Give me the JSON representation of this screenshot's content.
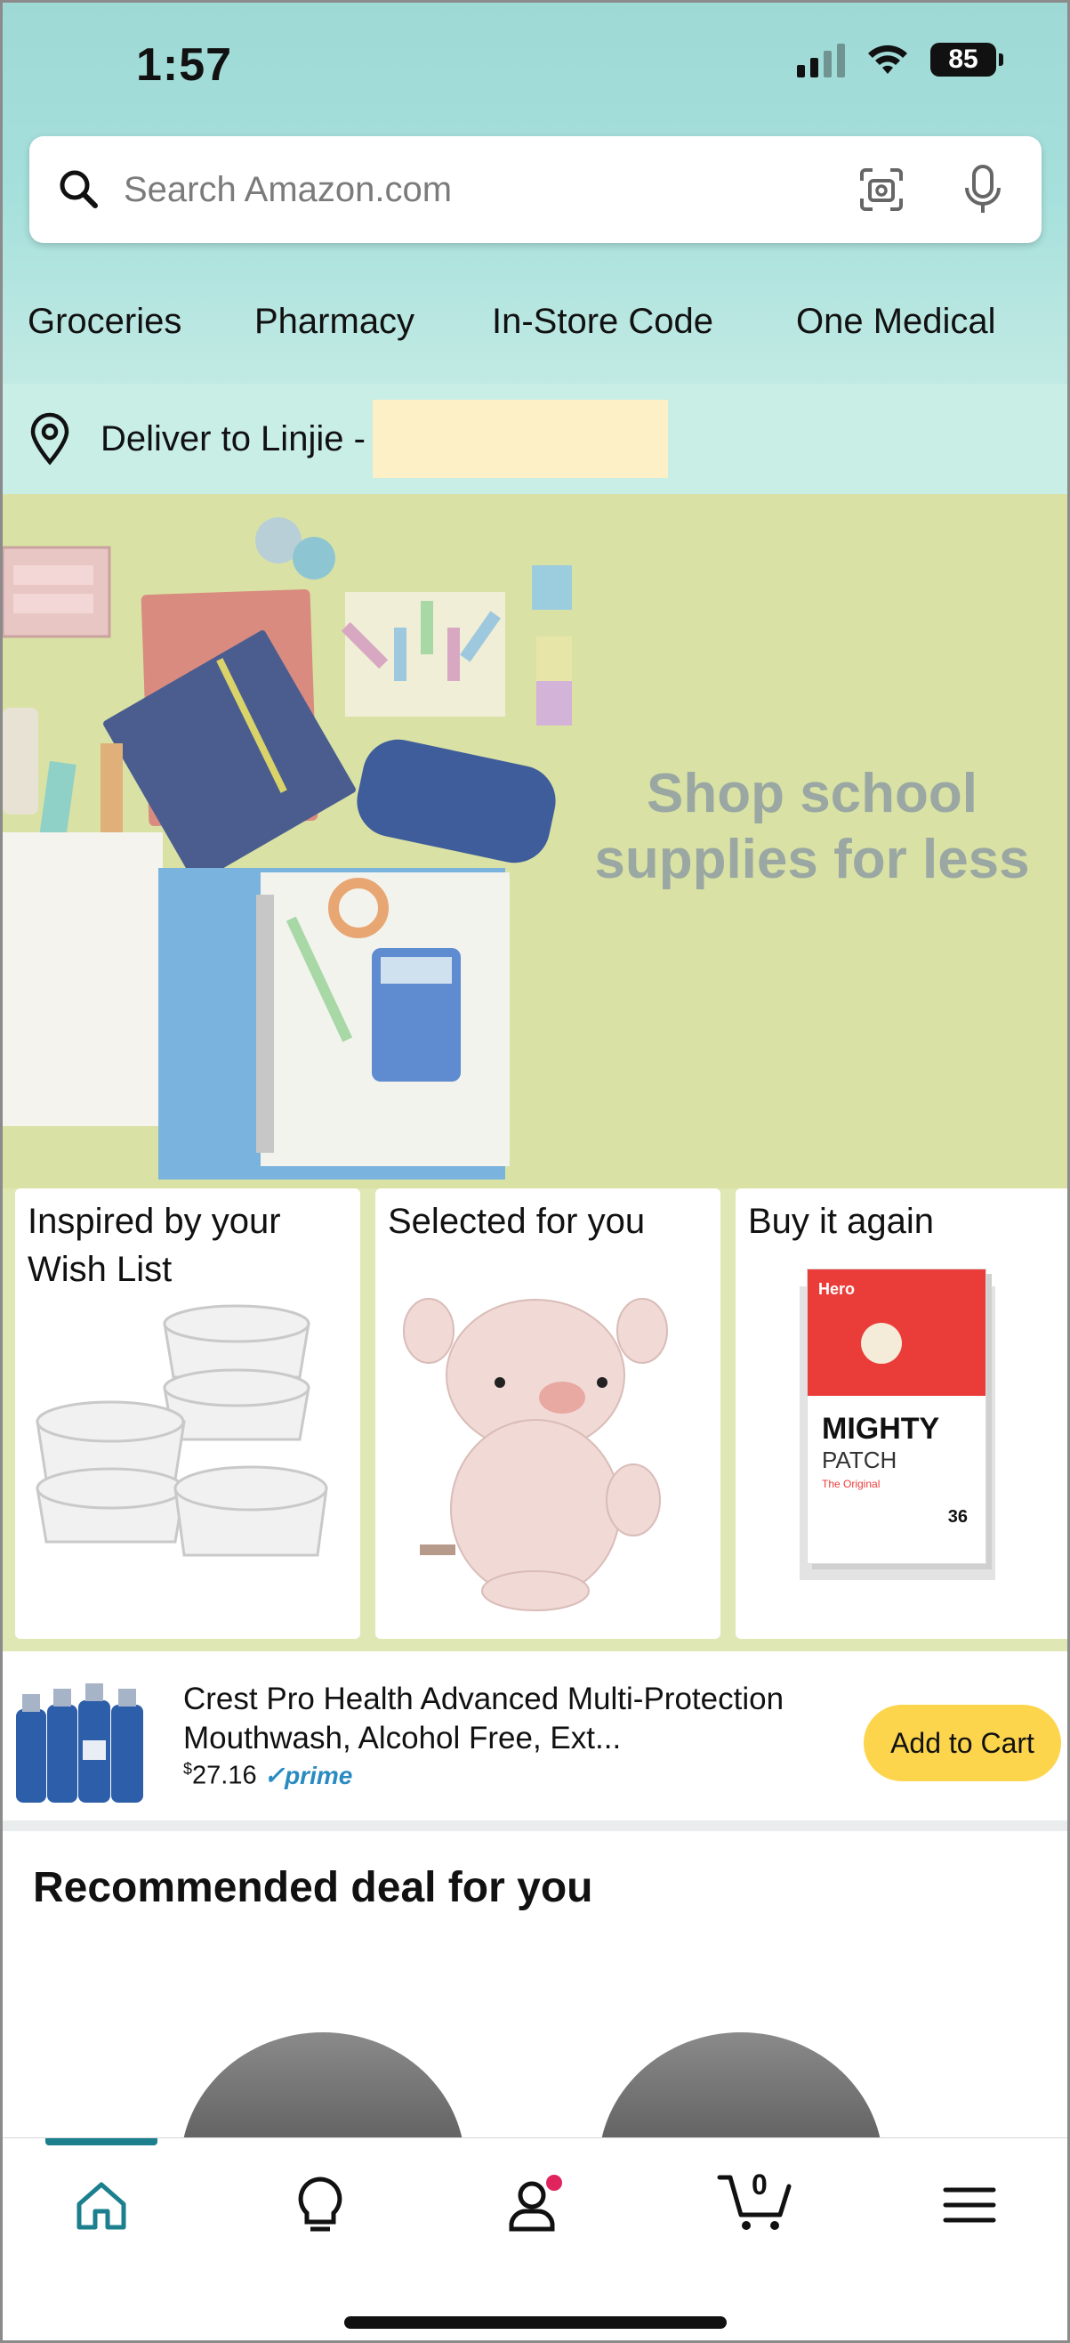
{
  "status_bar": {
    "time": "1:57",
    "battery": "85"
  },
  "search": {
    "placeholder": "Search Amazon.com"
  },
  "quick_links": [
    "Groceries",
    "Pharmacy",
    "In-Store Code",
    "One Medical"
  ],
  "deliver": {
    "label": "Deliver to Linjie -"
  },
  "hero": {
    "line1": "Shop school",
    "line2": "supplies for less"
  },
  "cards": [
    {
      "title": "Inspired by your Wish List"
    },
    {
      "title": "Selected for you"
    },
    {
      "title": "Buy it again",
      "product_brand": "Hero",
      "product_name": "MIGHTY",
      "product_sub": "PATCH",
      "product_tagline": "The Original",
      "product_count": "36"
    }
  ],
  "sponsored": {
    "title": "Crest Pro Health Advanced Multi-Protection Mouthwash, Alcohol Free, Ext...",
    "price": "27.16",
    "currency": "$",
    "prime": "prime",
    "button": "Add to Cart"
  },
  "deal": {
    "heading": "Recommended deal for you"
  },
  "nav": {
    "cart_count": "0"
  },
  "colors": {
    "accent": "#1b7f8e",
    "button": "#fcd54c",
    "prime": "#2a8bc1",
    "notification": "#e0245e"
  }
}
